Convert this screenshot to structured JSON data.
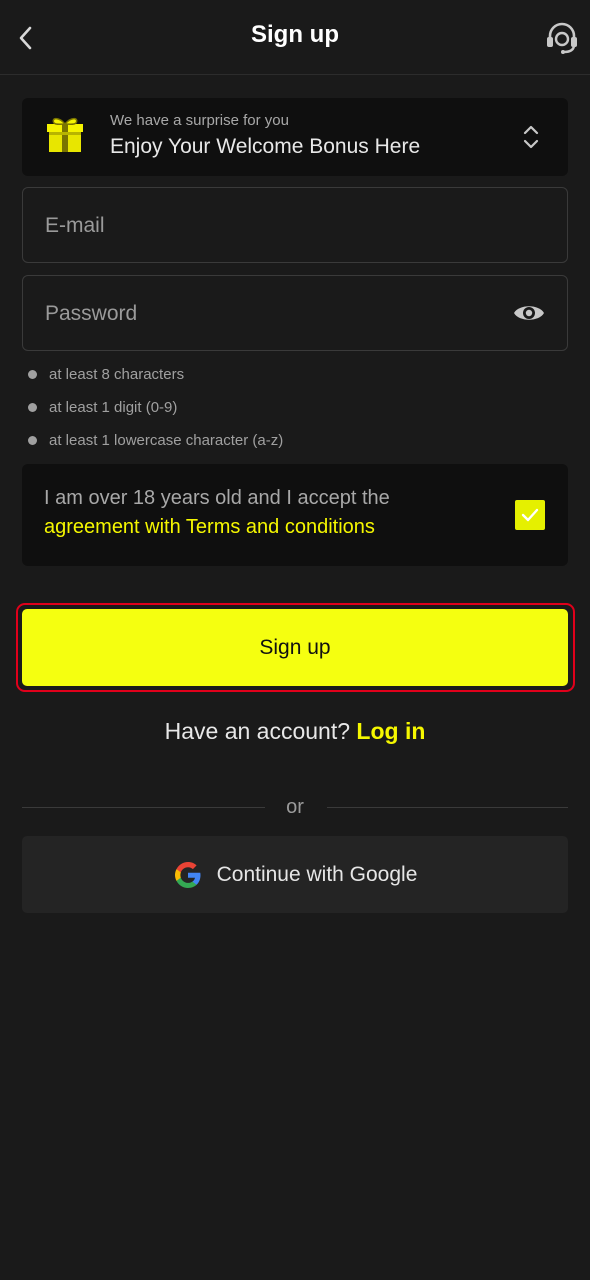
{
  "header": {
    "title": "Sign up",
    "back_icon": "chevron-left-icon",
    "support_icon": "headset-support-icon"
  },
  "bonus": {
    "subtitle": "We have a surprise for you",
    "title": "Enjoy Your Welcome Bonus Here",
    "icon": "gift-icon",
    "toggle_icon": "chevron-up-down-icon"
  },
  "form": {
    "email_placeholder": "E-mail",
    "password_placeholder": "Password",
    "password_toggle_icon": "eye-icon",
    "rules": [
      "at least 8 characters",
      "at least 1 digit (0-9)",
      "at least 1 lowercase character (a-z)"
    ]
  },
  "terms": {
    "text": "I am over 18 years old and I accept the",
    "link": "agreement with Terms and conditions",
    "checked": true
  },
  "signup_button": "Sign up",
  "login": {
    "question": "Have an account?",
    "link": "Log in"
  },
  "divider": "or",
  "google_button": "Continue with Google",
  "colors": {
    "background": "#1a1a1a",
    "card": "#0f0f0f",
    "accent": "#f5ff10",
    "link": "#f5f700",
    "highlight_border": "#e0001b"
  }
}
